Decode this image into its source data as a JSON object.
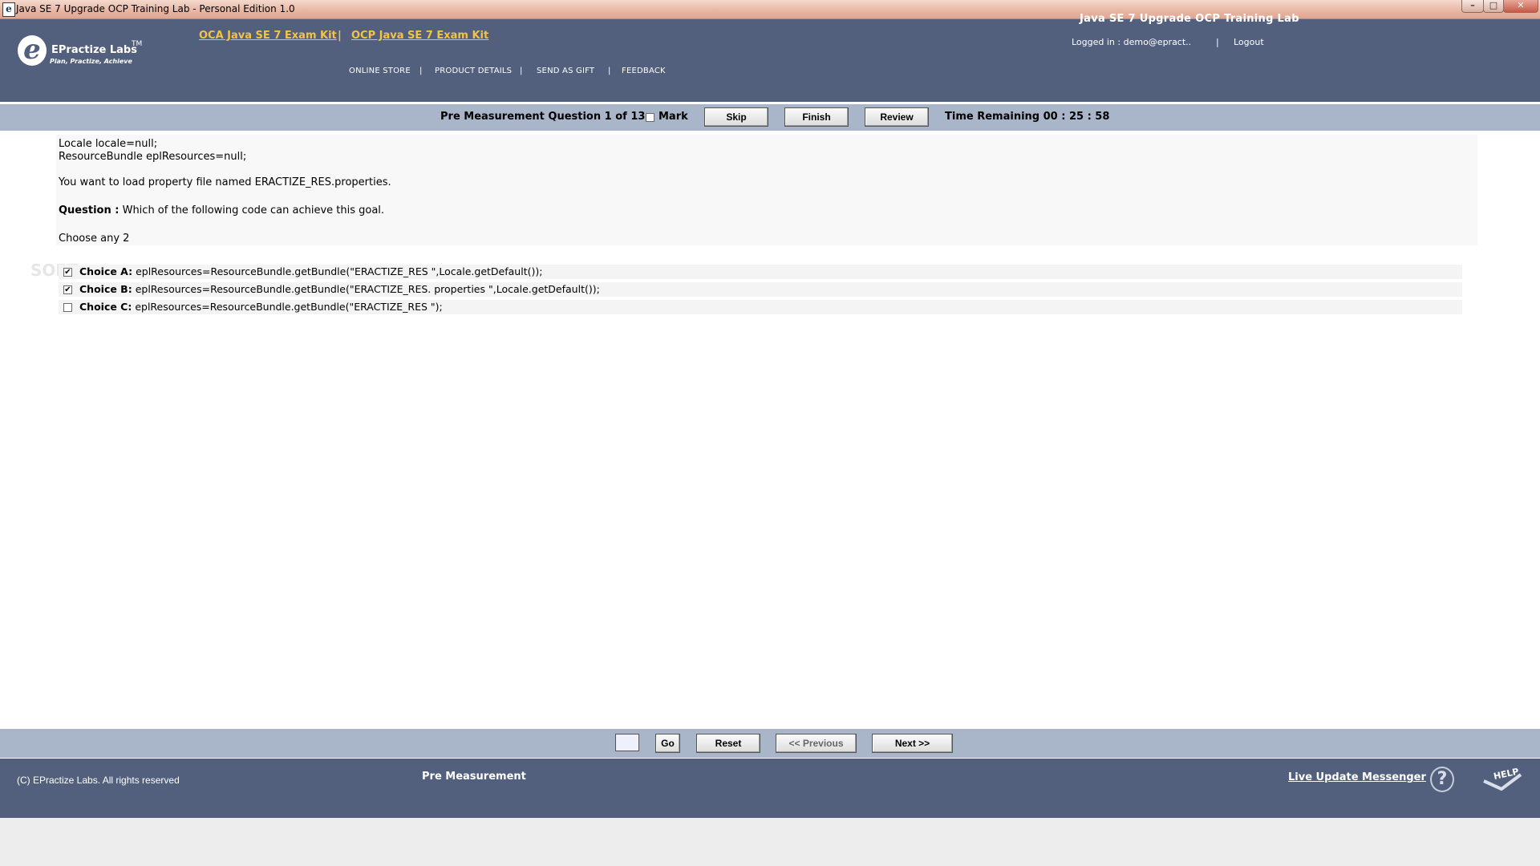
{
  "window": {
    "title": "Java SE 7 Upgrade OCP Training Lab - Personal Edition 1.0",
    "minimize": "–",
    "maximize": "□",
    "close": "✕"
  },
  "header": {
    "logo_letter": "e",
    "logo_name": "EPractize Labs",
    "logo_tm": "TM",
    "logo_tagline": "Plan, Practize, Achieve",
    "kit_links": [
      "OCA Java SE 7 Exam Kit",
      "OCP Java SE 7 Exam Kit"
    ],
    "kit_separator": "|",
    "nav": [
      "ONLINE STORE",
      "PRODUCT DETAILS",
      "SEND AS GIFT",
      "FEEDBACK"
    ],
    "nav_separator": "|",
    "app_title": "Java SE 7 Upgrade OCP Training Lab",
    "logged_in": "Logged in : demo@epract..",
    "logged_separator": "|",
    "logout": "Logout"
  },
  "toolbar": {
    "question_status": "Pre Measurement Question 1 of 13",
    "mark_label": "Mark",
    "mark_checked": false,
    "skip": "Skip",
    "finish": "Finish",
    "review": "Review",
    "time_remaining": "Time Remaining 00 : 25 : 58"
  },
  "question": {
    "code_line_1": "Locale locale=null;",
    "code_line_2": "ResourceBundle eplResources=null;",
    "context": "You want to load property file named ERACTIZE_RES.properties.",
    "question_label": "Question :",
    "question_text": " Which of the following code can achieve this goal.",
    "instruction": "Choose any 2"
  },
  "choices": [
    {
      "label": "Choice A:",
      "text": " eplResources=ResourceBundle.getBundle(\"ERACTIZE_RES \",Locale.getDefault());",
      "checked": true
    },
    {
      "label": "Choice B:",
      "text": " eplResources=ResourceBundle.getBundle(\"ERACTIZE_RES. properties \",Locale.getDefault());",
      "checked": true
    },
    {
      "label": "Choice C:",
      "text": " eplResources=ResourceBundle.getBundle(\"ERACTIZE_RES \");",
      "checked": false
    }
  ],
  "bottom_nav": {
    "goto_value": "",
    "go": "Go",
    "reset": "Reset",
    "previous": "<< Previous",
    "next": "Next >>"
  },
  "footer": {
    "copyright": "(C) EPractize Labs. All rights reserved",
    "mode": "Pre Measurement",
    "live_update": "Live Update Messenger",
    "help_symbol": "?",
    "help_label": "HELP"
  },
  "watermark": "SOFT",
  "colors": {
    "header_bg": "#52607e",
    "toolbar_bg": "#a9b6c9",
    "link_gold": "#f5c342"
  }
}
